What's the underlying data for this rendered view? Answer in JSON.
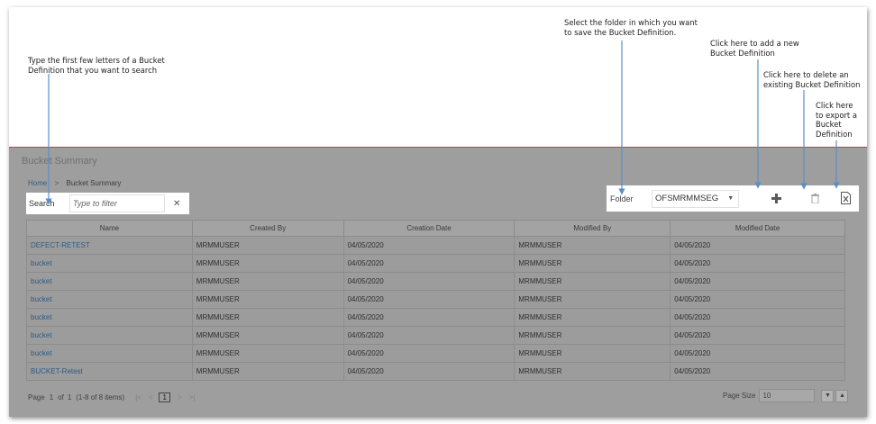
{
  "callouts": {
    "search": [
      "Type the first few letters of a Bucket",
      "Definition that you want to search"
    ],
    "folder": [
      "Select the folder in which you want",
      "to save the Bucket Definition."
    ],
    "add": [
      "Click here  to add a new",
      "Bucket Definition"
    ],
    "delete": [
      "Click here  to delete an",
      "existing Bucket Definition"
    ],
    "export": [
      "Click here",
      "to export a",
      "Bucket",
      "Definition"
    ]
  },
  "app": {
    "title": "Bucket Summary",
    "breadcrumb": {
      "home": "Home",
      "separator": ">",
      "current": "Bucket Summary"
    }
  },
  "search": {
    "label": "Search",
    "placeholder": "Type to filter",
    "clear_icon": "close-icon"
  },
  "toolbar": {
    "folder_label": "Folder",
    "folder_value": "OFSMRMMSEG",
    "icons": [
      "plus-icon",
      "trash-icon",
      "excel-export-icon"
    ]
  },
  "table": {
    "columns": [
      "Name",
      "Created By",
      "Creation Date",
      "Modified By",
      "Modified Date"
    ],
    "rows": [
      [
        "DEFECT-RETEST",
        "MRMMUSER",
        "04/05/2020",
        "MRMMUSER",
        "04/05/2020"
      ],
      [
        "bucket",
        "MRMMUSER",
        "04/05/2020",
        "MRMMUSER",
        "04/05/2020"
      ],
      [
        "bucket",
        "MRMMUSER",
        "04/05/2020",
        "MRMMUSER",
        "04/05/2020"
      ],
      [
        "bucket",
        "MRMMUSER",
        "04/05/2020",
        "MRMMUSER",
        "04/05/2020"
      ],
      [
        "bucket",
        "MRMMUSER",
        "04/05/2020",
        "MRMMUSER",
        "04/05/2020"
      ],
      [
        "bucket",
        "MRMMUSER",
        "04/05/2020",
        "MRMMUSER",
        "04/05/2020"
      ],
      [
        "bucket",
        "MRMMUSER",
        "04/05/2020",
        "MRMMUSER",
        "04/05/2020"
      ],
      [
        "BUCKET-Retest",
        "MRMMUSER",
        "04/05/2020",
        "MRMMUSER",
        "04/05/2020"
      ]
    ]
  },
  "pager": {
    "page_label": "Page",
    "page": "1",
    "of_label": "of",
    "total_pages": "1",
    "items_text": "(1-8 of 8 items)",
    "current_page": "1",
    "page_size_label": "Page Size",
    "page_size": "10"
  },
  "colors": {
    "overlay": "#9e9e9e",
    "link": "#2d5f86",
    "callout_line": "#5b8fc7",
    "top_border": "#b04848"
  }
}
